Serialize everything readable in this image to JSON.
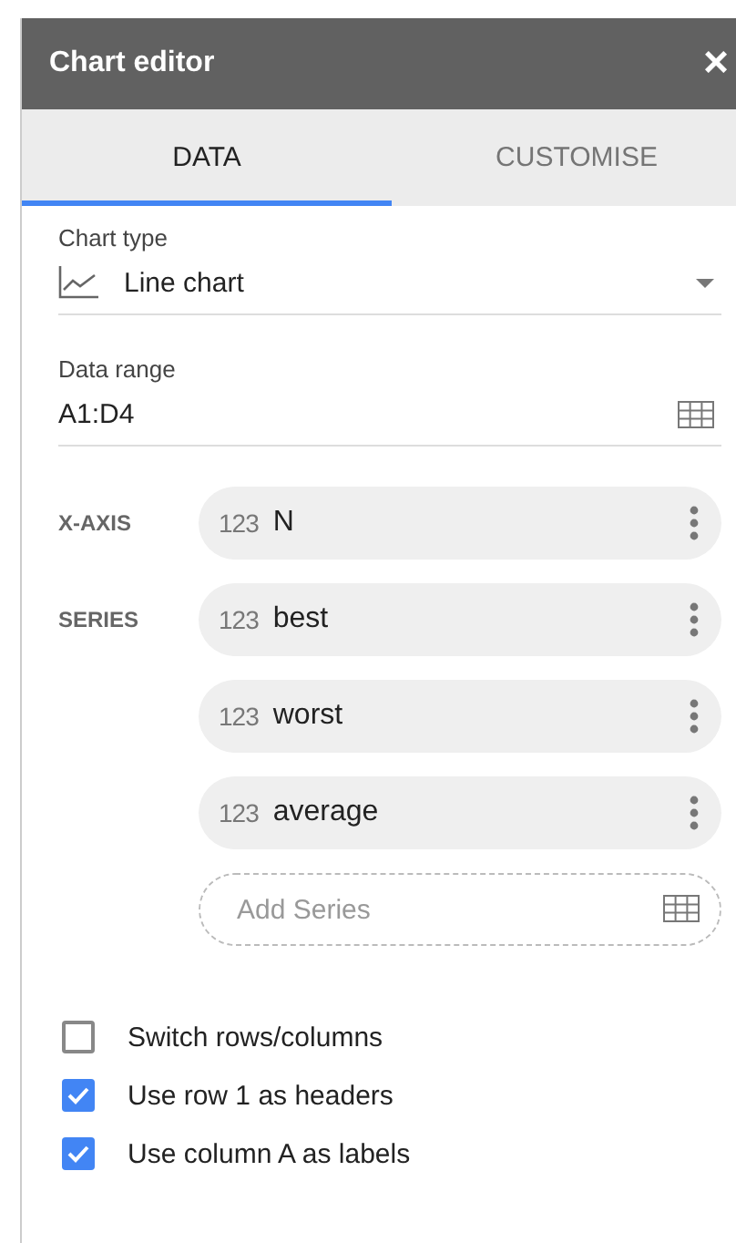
{
  "header": {
    "title": "Chart editor",
    "close": "×"
  },
  "tabs": [
    {
      "label": "DATA",
      "selected": true
    },
    {
      "label": "CUSTOMISE",
      "selected": false
    }
  ],
  "chart_type": {
    "label": "Chart type",
    "value": "Line chart"
  },
  "data_range": {
    "label": "Data range",
    "value": "A1:D4"
  },
  "x_axis": {
    "label": "X-AXIS",
    "items": [
      {
        "type_label": "123",
        "name": "N"
      }
    ]
  },
  "series": {
    "label": "SERIES",
    "items": [
      {
        "type_label": "123",
        "name": "best"
      },
      {
        "type_label": "123",
        "name": "worst"
      },
      {
        "type_label": "123",
        "name": "average"
      }
    ],
    "add_placeholder": "Add Series"
  },
  "options": [
    {
      "label": "Switch rows/columns",
      "checked": false
    },
    {
      "label": "Use row 1 as headers",
      "checked": true
    },
    {
      "label": "Use column A as labels",
      "checked": true
    }
  ]
}
